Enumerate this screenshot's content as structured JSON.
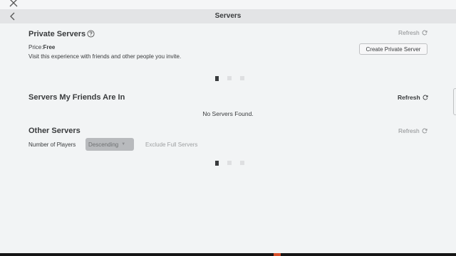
{
  "header": {
    "title": "Servers"
  },
  "private_servers": {
    "title": "Private Servers",
    "refresh_label": "Refresh",
    "price_label": "Price:",
    "price_value": "Free",
    "description": "Visit this experience with friends and other people you invite.",
    "create_button_label": "Create Private Server"
  },
  "friends_servers": {
    "title": "Servers My Friends Are In",
    "refresh_label": "Refresh",
    "empty_message": "No Servers Found."
  },
  "other_servers": {
    "title": "Other Servers",
    "refresh_label": "Refresh",
    "filter_label": "Number of Players",
    "sort_value": "Descending",
    "exclude_label": "Exclude Full Servers"
  },
  "colors": {
    "background": "#f2f4f5",
    "header_bar": "#e3e4e6",
    "text": "#393b3d",
    "muted_text": "#8c8e90",
    "select_bg": "#b8babd"
  }
}
